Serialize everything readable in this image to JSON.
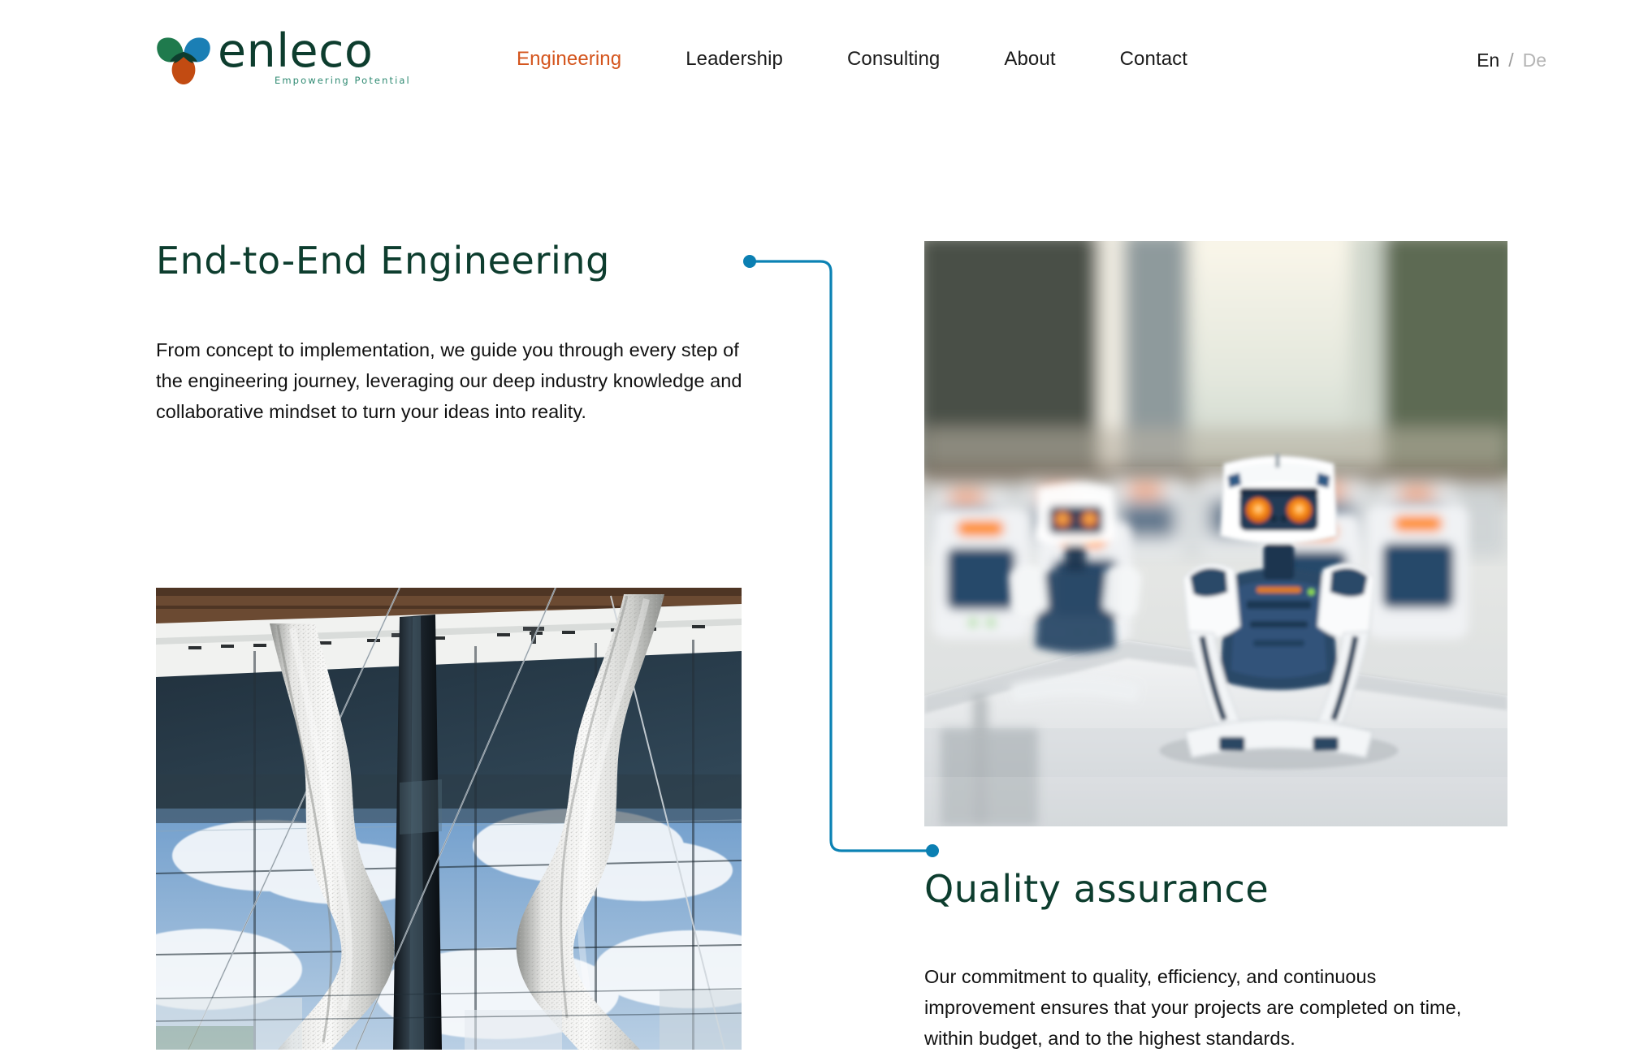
{
  "brand": {
    "name": "enleco",
    "tagline": "Empowering Potential",
    "logo_icon": "trefoil-leaf-logo",
    "colors": {
      "green": "#1f7a4d",
      "blue": "#1b7fb5",
      "orange": "#c24b12",
      "dark_green": "#0d3d2e"
    }
  },
  "nav": {
    "items": [
      {
        "label": "Engineering",
        "active": true
      },
      {
        "label": "Leadership",
        "active": false
      },
      {
        "label": "Consulting",
        "active": false
      },
      {
        "label": "About",
        "active": false
      },
      {
        "label": "Contact",
        "active": false
      }
    ],
    "active_color": "#d4551d"
  },
  "language": {
    "current": "En",
    "separator": "/",
    "other": "De"
  },
  "sections": [
    {
      "id": "end-to-end-engineering",
      "heading": "End-to-End Engineering",
      "body": "From concept to implementation, we guide you through every step of the engineering journey, leveraging our deep industry knowledge and collaborative mindset to turn your ideas into reality.",
      "marker": "connector-dot-start"
    },
    {
      "id": "quality-assurance",
      "heading": "Quality assurance",
      "body": "Our commitment to quality, efficiency, and continuous improvement ensures that your projects are completed on time, within budget, and to the highest standards.",
      "marker": "connector-dot-end"
    }
  ],
  "media": {
    "robots": {
      "alt": "Rows of white and navy humanoid robots with glowing orange eyes on a laboratory table",
      "name": "robots-photo"
    },
    "facade": {
      "alt": "Twisted textured white columns in front of a reflective glass building facade with sky",
      "name": "architecture-facade-photo"
    }
  },
  "connector": {
    "color": "#0b82b4",
    "name": "section-connector-line"
  }
}
